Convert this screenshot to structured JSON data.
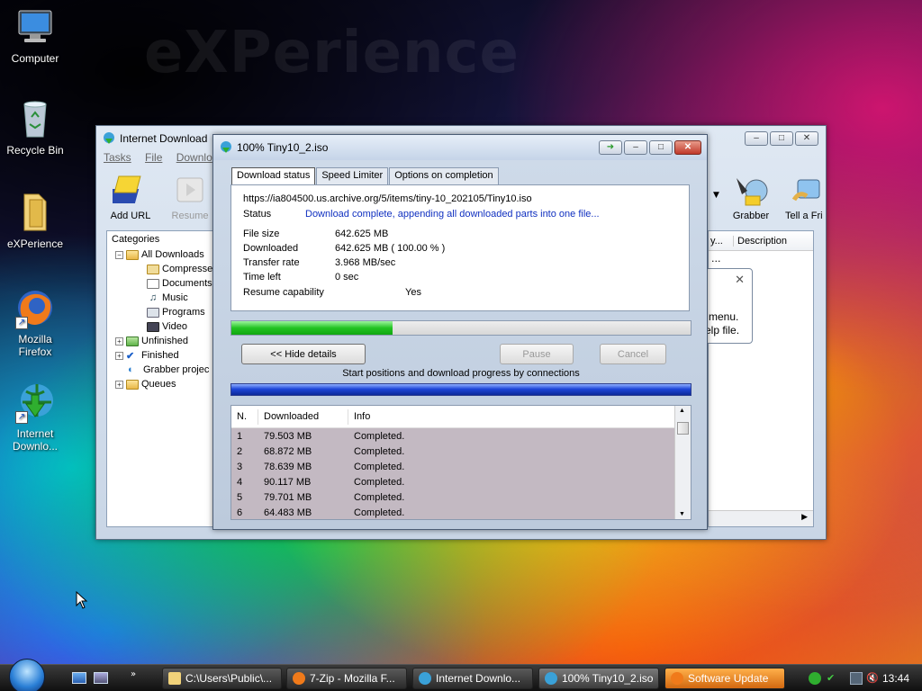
{
  "desktop": {
    "watermark": "eXPerience",
    "icons": [
      {
        "label": "Computer"
      },
      {
        "label": "Recycle Bin"
      },
      {
        "label": "eXPerience"
      },
      {
        "label": "Mozilla\nFirefox"
      },
      {
        "label": "Internet\nDownlo..."
      }
    ]
  },
  "main_window": {
    "title": "Internet Download",
    "menu": [
      "Tasks",
      "File",
      "Downlo"
    ],
    "toolbar": {
      "add_url": "Add URL",
      "resume": "Resume",
      "grabber": "Grabber",
      "tell_friend": "Tell a Fri"
    },
    "categories_label": "Categories",
    "tree": [
      {
        "label": "All Downloads"
      },
      {
        "label": "Compresse"
      },
      {
        "label": "Documents"
      },
      {
        "label": "Music"
      },
      {
        "label": "Programs"
      },
      {
        "label": "Video"
      },
      {
        "label": "Unfinished"
      },
      {
        "label": "Finished"
      },
      {
        "label": "Grabber projec"
      },
      {
        "label": "Queues"
      }
    ],
    "list_header": {
      "col1": "y...",
      "col2": "Description"
    },
    "list_cell": "...",
    "tip_line1": "menu.",
    "tip_line2": "elp file."
  },
  "dialog": {
    "title": "100% Tiny10_2.iso",
    "tabs": [
      "Download status",
      "Speed Limiter",
      "Options on completion"
    ],
    "url": "https://ia804500.us.archive.org/5/items/tiny-10_202105/Tiny10.iso",
    "status_label": "Status",
    "status_value": "Download complete, appending all downloaded parts into one file...",
    "file_size_label": "File size",
    "file_size_value": "642.625  MB",
    "downloaded_label": "Downloaded",
    "downloaded_value": "642.625  MB  ( 100.00 % )",
    "transfer_rate_label": "Transfer rate",
    "transfer_rate_value": "3.968  MB/sec",
    "time_left_label": "Time left",
    "time_left_value": "0 sec",
    "resume_label": "Resume capability",
    "resume_value": "Yes",
    "progress_fraction": 0.35,
    "hide_details": "<< Hide details",
    "pause": "Pause",
    "cancel": "Cancel",
    "connections_caption": "Start positions and download progress by connections",
    "table_headers": [
      "N.",
      "Downloaded",
      "Info"
    ],
    "rows": [
      {
        "n": "1",
        "downloaded": "79.503  MB",
        "info": "Completed."
      },
      {
        "n": "2",
        "downloaded": "68.872  MB",
        "info": "Completed."
      },
      {
        "n": "3",
        "downloaded": "78.639  MB",
        "info": "Completed."
      },
      {
        "n": "4",
        "downloaded": "90.117  MB",
        "info": "Completed."
      },
      {
        "n": "5",
        "downloaded": "79.701  MB",
        "info": "Completed."
      },
      {
        "n": "6",
        "downloaded": "64.483  MB",
        "info": "Completed."
      }
    ]
  },
  "taskbar": {
    "buttons": [
      {
        "label": "C:\\Users\\Public\\..."
      },
      {
        "label": "7-Zip - Mozilla F..."
      },
      {
        "label": "Internet Downlo..."
      },
      {
        "label": "100% Tiny10_2.iso"
      },
      {
        "label": "Software Update"
      }
    ],
    "clock": "13:44"
  }
}
